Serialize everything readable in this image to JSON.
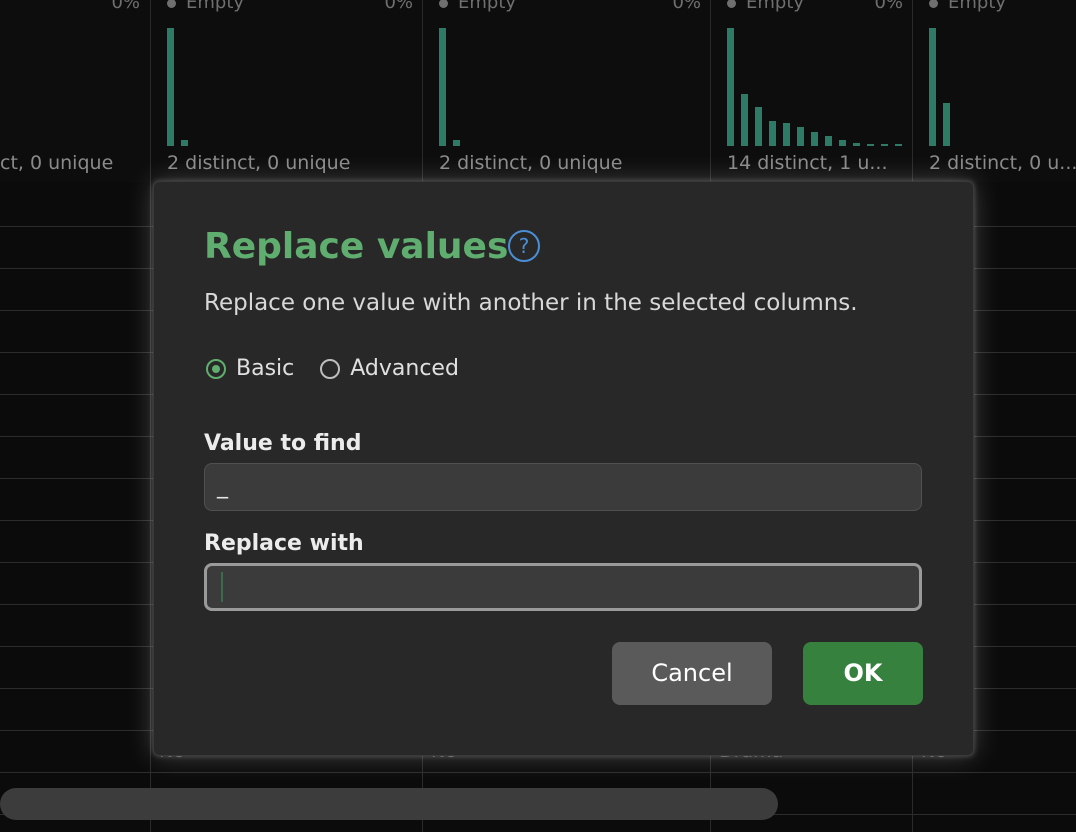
{
  "columns": [
    {
      "header": "Empty",
      "pct": "0%",
      "summary": "2 distinct, 0 unique"
    },
    {
      "header": "Empty",
      "pct": "0%",
      "summary": "2 distinct, 0 unique"
    },
    {
      "header": "Empty",
      "pct": "0%",
      "summary": "14 distinct, 1 u..."
    },
    {
      "header": "Empty",
      "pct": "0",
      "summary": "2 distinct, 0 u..."
    }
  ],
  "first_column": {
    "pct": "0%",
    "summary": "ct, 0 unique"
  },
  "ghost_cells": [
    "No",
    "No",
    "Drama",
    "No"
  ],
  "dialog": {
    "title": "Replace values",
    "description": "Replace one value with another in the selected columns.",
    "mode_options": [
      {
        "label": "Basic",
        "checked": true
      },
      {
        "label": "Advanced",
        "checked": false
      }
    ],
    "find_label": "Value to find",
    "find_value": "_",
    "replace_label": "Replace with",
    "replace_value": "",
    "cancel_label": "Cancel",
    "ok_label": "OK"
  },
  "colors": {
    "accent": "#5fae6f",
    "ok_button": "#37813f",
    "help": "#4a8fd6",
    "bars": "#2d7a66"
  }
}
